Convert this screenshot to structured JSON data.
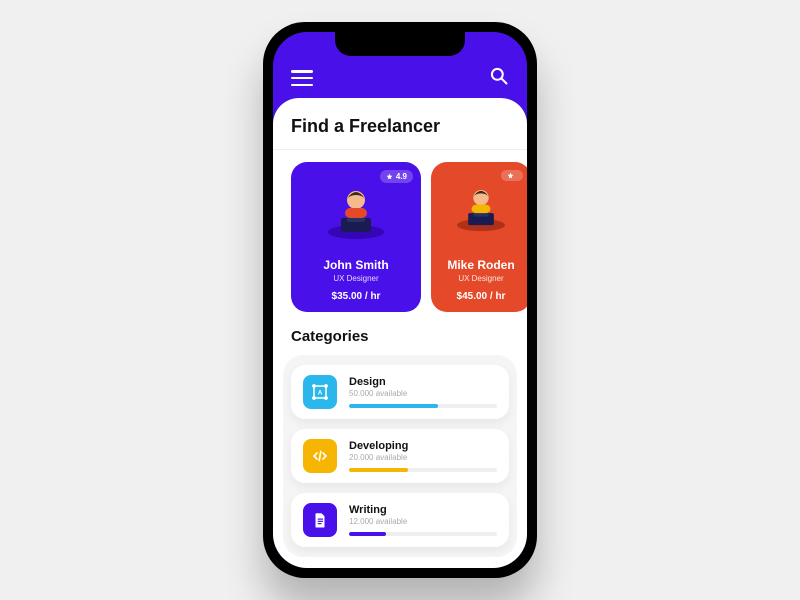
{
  "header": {
    "page_title": "Find a Freelancer"
  },
  "freelancers": [
    {
      "name": "John Smith",
      "role": "UX Designer",
      "rate": "$35.00 / hr",
      "rating": "4.9",
      "color": "purple"
    },
    {
      "name": "Mike Roden",
      "role": "UX Designer",
      "rate": "$45.00 / hr",
      "rating": "",
      "color": "red"
    }
  ],
  "categories_title": "Categories",
  "categories": [
    {
      "name": "Design",
      "sub": "50.000 available",
      "color": "blue",
      "progress": 60
    },
    {
      "name": "Developing",
      "sub": "20.000 available",
      "color": "yellow",
      "progress": 40
    },
    {
      "name": "Writing",
      "sub": "12.000 available",
      "color": "violet",
      "progress": 25
    }
  ]
}
